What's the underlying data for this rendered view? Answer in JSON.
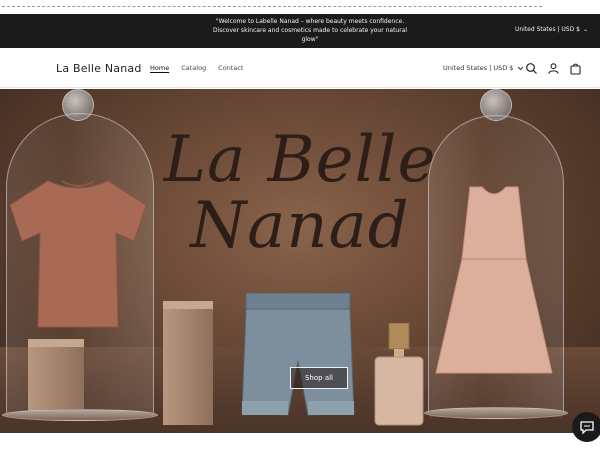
{
  "announcement": {
    "message": "\"Welcome to Labelle Nanad – where beauty meets confidence. Discover skincare and cosmetics made to celebrate your natural glow\"",
    "currency": "United States | USD $"
  },
  "header": {
    "brand": "La Belle Nanad",
    "nav": [
      "Home",
      "Catalog",
      "Contact"
    ],
    "currency": "United States | USD $",
    "icons": [
      "search-icon",
      "account-icon",
      "cart-icon"
    ]
  },
  "hero": {
    "title_line1": "La Belle",
    "title_line2": "Nanad",
    "cta": "Shop all"
  },
  "colors": {
    "announcement_bg": "#1b1b1b",
    "hero_tone": "#6e4c39",
    "title": "#2d1e17"
  }
}
